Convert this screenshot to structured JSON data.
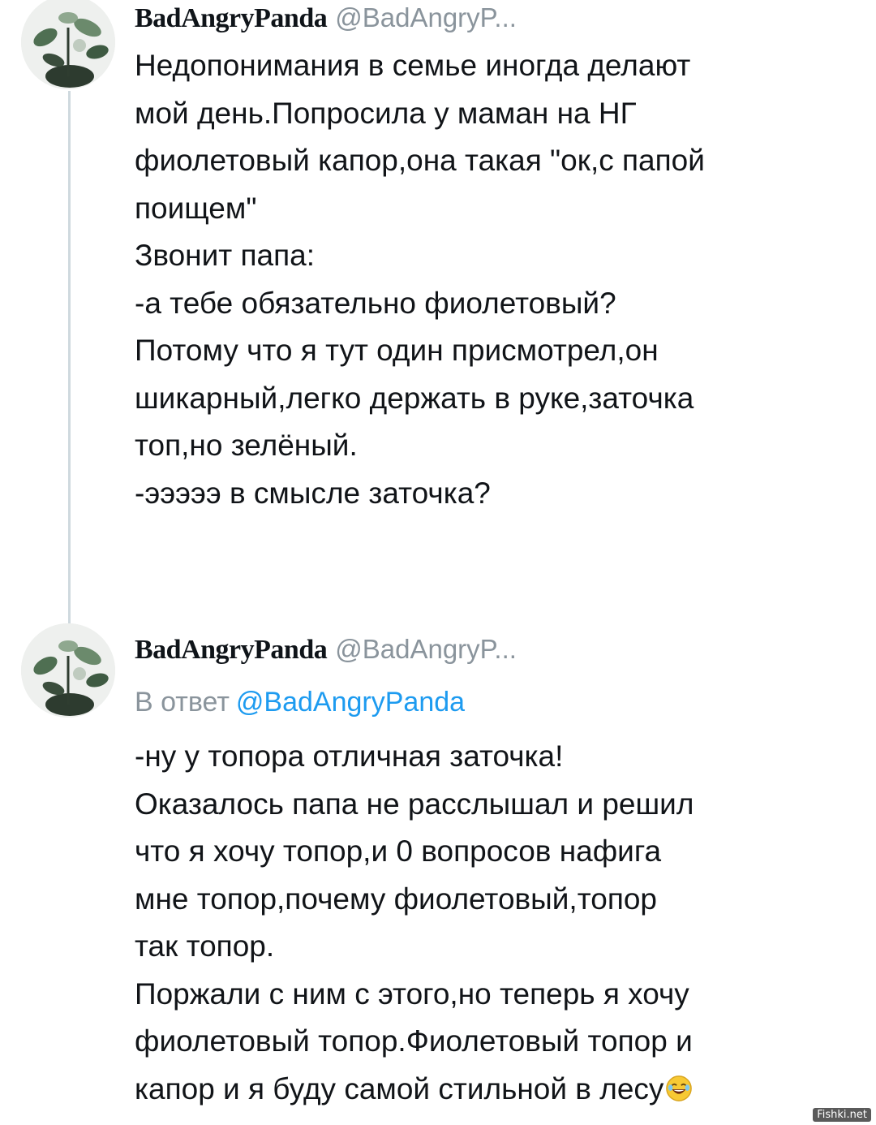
{
  "tweets": [
    {
      "author": "BadAngryPanda",
      "handle": "@BadAngryP...",
      "lines": [
        "Недопонимания в семье иногда делают",
        "мой день.Попросила у маман на НГ",
        "фиолетовый капор,она такая \"ок,с папой",
        "поищем\"",
        "Звонит папа:",
        "-а тебе обязательно фиолетовый?",
        "Потому что я тут один присмотрел,он",
        "шикарный,легко держать в руке,заточка",
        "топ,но зелёный.",
        "-эээээ в смысле заточка?"
      ]
    },
    {
      "author": "BadAngryPanda",
      "handle": "@BadAngryP...",
      "reply_prefix": "В ответ",
      "reply_to": "@BadAngryPanda",
      "lines": [
        "-ну у топора отличная заточка!",
        "Оказалось папа не расслышал и решил",
        "что я хочу топор,и 0 вопросов нафига",
        "мне топор,почему фиолетовый,топор",
        "так топор.",
        "Поржали с ним с этого,но теперь я хочу",
        "фиолетовый топор.Фиолетовый топор и",
        "капор и я буду самой стильной в лесу"
      ],
      "trailing_emoji": "laughing-face-icon"
    }
  ],
  "watermark": "Fishki.net",
  "colors": {
    "handle": "#8a949c",
    "link": "#1d9bf0",
    "thread_line": "#cfd9de",
    "text": "#111418"
  }
}
